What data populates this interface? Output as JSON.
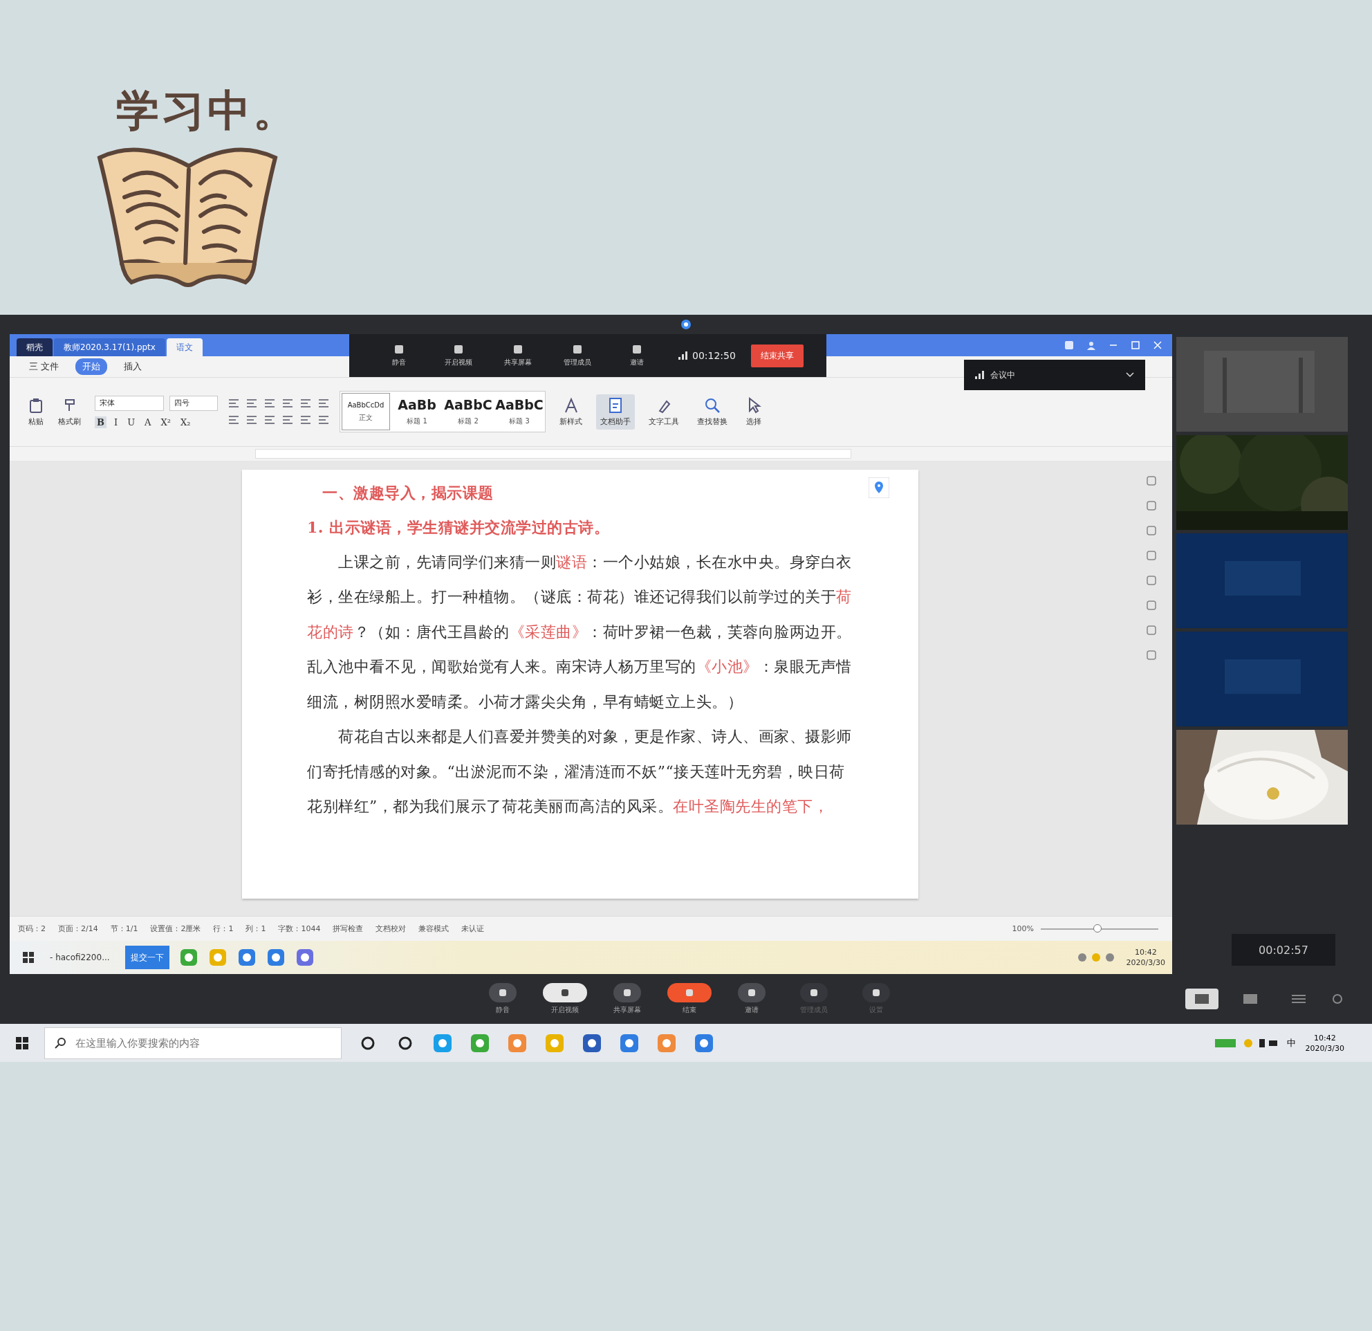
{
  "sticker": {
    "title": "学习中。"
  },
  "share_toolbar": {
    "buttons": [
      {
        "label": "静音"
      },
      {
        "label": "开启视频"
      },
      {
        "label": "共享屏幕"
      },
      {
        "label": "管理成员"
      },
      {
        "label": "邀请"
      }
    ],
    "timer": "00:12:50",
    "stop": "结束共享",
    "status": "会议中"
  },
  "wps": {
    "tabs": [
      {
        "label": "稻壳",
        "selected": false
      },
      {
        "label": "教师2020.3.17(1).pptx",
        "selected": false
      },
      {
        "label": "语文",
        "selected": true
      }
    ],
    "menu": [
      {
        "label": "三 文件",
        "selected": false
      },
      {
        "label": "开始",
        "selected": true
      },
      {
        "label": "插入",
        "selected": false
      }
    ],
    "clipboard": [
      {
        "label": "粘贴"
      },
      {
        "label": "格式刷"
      }
    ],
    "font": {
      "name": "宋体",
      "size": "四号"
    },
    "format_buttons": [
      "B",
      "I",
      "U",
      "A",
      "X²",
      "X₂"
    ],
    "styles": [
      {
        "sample": "AaBbCcDd",
        "label": "正文",
        "selected": true
      },
      {
        "sample": "AaBb",
        "label": "标题 1",
        "selected": false
      },
      {
        "sample": "AaBbC",
        "label": "标题 2",
        "selected": false
      },
      {
        "sample": "AaBbC",
        "label": "标题 3",
        "selected": false
      }
    ],
    "tools": [
      {
        "label": "新样式",
        "selected": false
      },
      {
        "label": "文档助手",
        "selected": true
      },
      {
        "label": "文字工具",
        "selected": false
      },
      {
        "label": "查找替换",
        "selected": false
      },
      {
        "label": "选择",
        "selected": false
      }
    ],
    "document": {
      "paragraphs": [
        {
          "kind": "heading",
          "runs": [
            {
              "text": "一、激趣导入，揭示课题",
              "red": true
            }
          ]
        },
        {
          "kind": "subheading",
          "runs": [
            {
              "text": "1. 出示谜语，学生猜谜并交流学过的古诗。",
              "red": true
            }
          ]
        },
        {
          "kind": "body",
          "runs": [
            {
              "text": "上课之前，先请同学们来猜一则",
              "red": false
            },
            {
              "text": "谜语",
              "red": true
            },
            {
              "text": "：一个小姑娘，长在水中央。身穿白衣衫，坐在绿船上。打一种植物。（谜底：荷花）谁还记得我们以前学过的关于",
              "red": false
            },
            {
              "text": "荷花的诗",
              "red": true
            },
            {
              "text": "？（如：唐代王昌龄的",
              "red": false
            },
            {
              "text": "《采莲曲》",
              "red": true
            },
            {
              "text": "：荷叶罗裙一色裁，芙蓉向脸两边开。乱入池中看不见，闻歌始觉有人来。南宋诗人杨万里写的",
              "red": false
            },
            {
              "text": "《小池》",
              "red": true
            },
            {
              "text": "：泉眼无声惜细流，树阴照水爱晴柔。小荷才露尖尖角，早有蜻蜓立上头。）",
              "red": false
            }
          ]
        },
        {
          "kind": "body",
          "runs": [
            {
              "text": "荷花自古以来都是人们喜爱并赞美的对象，更是作家、诗人、画家、摄影师们寄托情感的对象。“出淤泥而不染，濯清涟而不妖”“接天莲叶无穷碧，映日荷花别样红”，都为我们展示了荷花美丽而高洁的风采。",
              "red": false
            },
            {
              "text": "在叶圣陶先生的笔下，",
              "red": true
            }
          ]
        }
      ]
    },
    "status_bar": {
      "items": [
        "页码：2",
        "页面：2/14",
        "节：1/1",
        "设置值：2厘米",
        "行：1",
        "列：1",
        "字数：1044",
        "拼写检查",
        "文档校对",
        "兼容模式",
        "未认证"
      ],
      "zoom": "100%",
      "zoom_slider": {
        "level": 0.48
      }
    },
    "inner_taskbar": {
      "items": [
        {
          "label": "- hacofi2200...",
          "selected": false
        },
        {
          "label": "提交一下",
          "selected": true
        }
      ],
      "time": "10:42",
      "date": "2020/3/30"
    }
  },
  "participants": {
    "call_timer": "00:02:57"
  },
  "meeting_bar": {
    "buttons": [
      {
        "label": "静音",
        "kind": "normal"
      },
      {
        "label": "开启视频",
        "kind": "active"
      },
      {
        "label": "共享屏幕",
        "kind": "normal"
      },
      {
        "label": "结束",
        "kind": "danger"
      },
      {
        "label": "邀请",
        "kind": "normal"
      },
      {
        "label": "管理成员",
        "kind": "dim"
      },
      {
        "label": "设置",
        "kind": "dim"
      }
    ]
  },
  "taskbar": {
    "search_placeholder": "在这里输入你要搜索的内容",
    "ime": "中",
    "time": "10:42",
    "date": "2020/3/30"
  }
}
